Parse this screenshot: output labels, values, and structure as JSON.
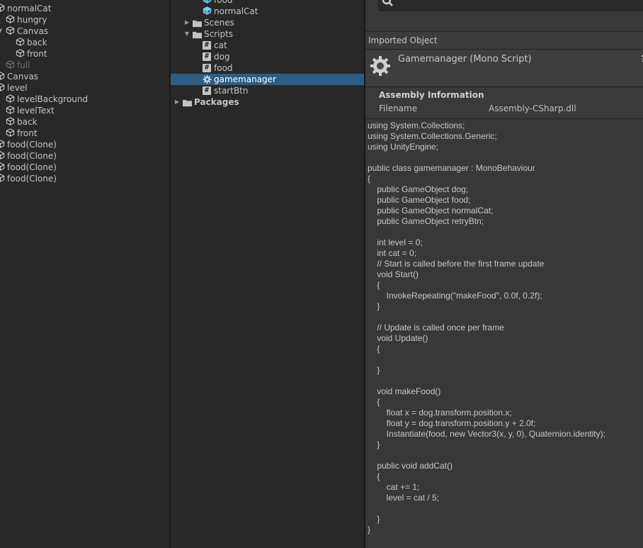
{
  "hierarchy": {
    "items": [
      {
        "label": "normalCat",
        "depth": 0,
        "icon": "cube-icon",
        "arrow": "none",
        "disabled": false
      },
      {
        "label": "hungry",
        "depth": 1,
        "icon": "cube-icon",
        "arrow": "none",
        "disabled": false
      },
      {
        "label": "Canvas",
        "depth": 1,
        "icon": "cube-icon",
        "arrow": "expanded",
        "disabled": false
      },
      {
        "label": "back",
        "depth": 2,
        "icon": "cube-icon",
        "arrow": "none",
        "disabled": false
      },
      {
        "label": "front",
        "depth": 2,
        "icon": "cube-icon",
        "arrow": "none",
        "disabled": false
      },
      {
        "label": "full",
        "depth": 1,
        "icon": "cube-icon",
        "arrow": "none",
        "disabled": true
      },
      {
        "label": "Canvas",
        "depth": 0,
        "icon": "cube-icon",
        "arrow": "none",
        "disabled": false
      },
      {
        "label": "level",
        "depth": 0,
        "icon": "cube-icon",
        "arrow": "expanded",
        "disabled": false
      },
      {
        "label": "levelBackground",
        "depth": 1,
        "icon": "cube-icon",
        "arrow": "none",
        "disabled": false
      },
      {
        "label": "levelText",
        "depth": 1,
        "icon": "cube-icon",
        "arrow": "none",
        "disabled": false
      },
      {
        "label": "back",
        "depth": 1,
        "icon": "cube-icon",
        "arrow": "none",
        "disabled": false
      },
      {
        "label": "front",
        "depth": 1,
        "icon": "cube-icon",
        "arrow": "none",
        "disabled": false
      },
      {
        "label": "food(Clone)",
        "depth": 0,
        "icon": "cube-icon",
        "arrow": "none",
        "disabled": false
      },
      {
        "label": "food(Clone)",
        "depth": 0,
        "icon": "cube-icon",
        "arrow": "none",
        "disabled": false
      },
      {
        "label": "food(Clone)",
        "depth": 0,
        "icon": "cube-icon",
        "arrow": "none",
        "disabled": false
      },
      {
        "label": "food(Clone)",
        "depth": 0,
        "icon": "cube-icon",
        "arrow": "none",
        "disabled": false
      }
    ]
  },
  "project": {
    "items": [
      {
        "label": "food",
        "depth": 2,
        "icon": "prefab-icon",
        "arrow": "none",
        "selected": false
      },
      {
        "label": "normalCat",
        "depth": 2,
        "icon": "prefab-icon",
        "arrow": "none",
        "selected": false
      },
      {
        "label": "Scenes",
        "depth": 1,
        "icon": "folder-icon",
        "arrow": "collapsed",
        "selected": false
      },
      {
        "label": "Scripts",
        "depth": 1,
        "icon": "folder-icon",
        "arrow": "expanded",
        "selected": false
      },
      {
        "label": "cat",
        "depth": 2,
        "icon": "script-icon",
        "arrow": "none",
        "selected": false
      },
      {
        "label": "dog",
        "depth": 2,
        "icon": "script-icon",
        "arrow": "none",
        "selected": false
      },
      {
        "label": "food",
        "depth": 2,
        "icon": "script-icon",
        "arrow": "none",
        "selected": false
      },
      {
        "label": "gamemanager",
        "depth": 2,
        "icon": "gear-icon",
        "arrow": "none",
        "selected": true
      },
      {
        "label": "startBtn",
        "depth": 2,
        "icon": "script-icon",
        "arrow": "none",
        "selected": false
      },
      {
        "label": "Packages",
        "depth": 0,
        "icon": "folder-icon",
        "arrow": "collapsed",
        "selected": false,
        "bold": true
      }
    ]
  },
  "inspector": {
    "imported_header": "Imported Object",
    "object_title": "Gamemanager (Mono Script)",
    "help_glyph": "?",
    "assembly": {
      "title": "Assembly Information",
      "key": "Filename",
      "value": "Assembly-CSharp.dll"
    },
    "code_lines": [
      "using System.Collections;",
      "using System.Collections.Generic;",
      "using UnityEngine;",
      "",
      "public class gamemanager : MonoBehaviour",
      "{",
      "    public GameObject dog;",
      "    public GameObject food;",
      "    public GameObject normalCat;",
      "    public GameObject retryBtn;",
      "",
      "    int level = 0;",
      "    int cat = 0;",
      "    // Start is called before the first frame update",
      "    void Start()",
      "    {",
      "        InvokeRepeating(\"makeFood\", 0.0f, 0.2f);",
      "    }",
      "",
      "    // Update is called once per frame",
      "    void Update()",
      "    {",
      "",
      "    }",
      "",
      "    void makeFood()",
      "    {",
      "        float x = dog.transform.position.x;",
      "        float y = dog.transform.position.y + 2.0f;",
      "        Instantiate(food, new Vector3(x, y, 0), Quaternion.identity);",
      "    }",
      "",
      "    public void addCat()",
      "    {",
      "        cat += 1;",
      "        level = cat / 5;",
      "",
      "    }",
      "}"
    ]
  }
}
